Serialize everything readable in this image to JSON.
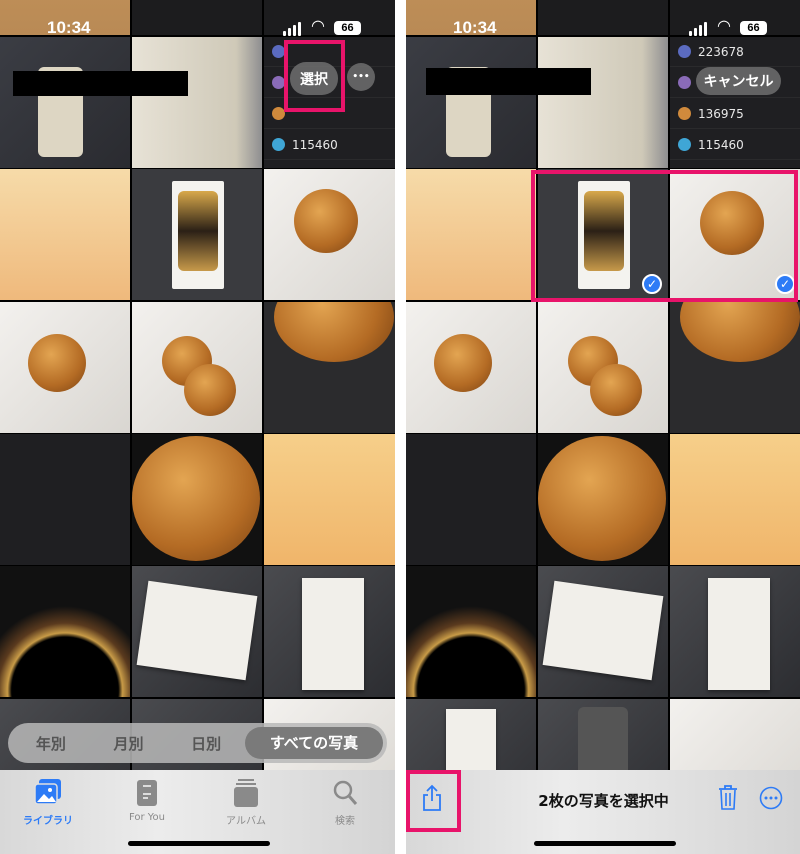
{
  "status_bar": {
    "time": "10:34",
    "battery": "66"
  },
  "left": {
    "select_button": "選択",
    "more_button": "•••",
    "list_numbers": [
      "115460"
    ],
    "segments": [
      "年別",
      "月別",
      "日別",
      "すべての写真"
    ],
    "selected_segment": "すべての写真",
    "tabs": [
      {
        "label": "ライブラリ",
        "icon": "photo-library-icon",
        "active": true
      },
      {
        "label": "For You",
        "icon": "for-you-icon"
      },
      {
        "label": "アルバム",
        "icon": "album-icon"
      },
      {
        "label": "検索",
        "icon": "search-icon"
      }
    ]
  },
  "right": {
    "cancel_button": "キャンセル",
    "list_numbers": [
      "223678",
      "136975",
      "115460"
    ],
    "selection_status": "2枚の写真を選択中",
    "selected_count": 2,
    "toolbar": {
      "share": "share-icon",
      "trash": "trash-icon",
      "more": "ellipsis-circle-icon"
    }
  },
  "colors": {
    "highlight": "#e8146a",
    "accent": "#2d7bf6"
  }
}
